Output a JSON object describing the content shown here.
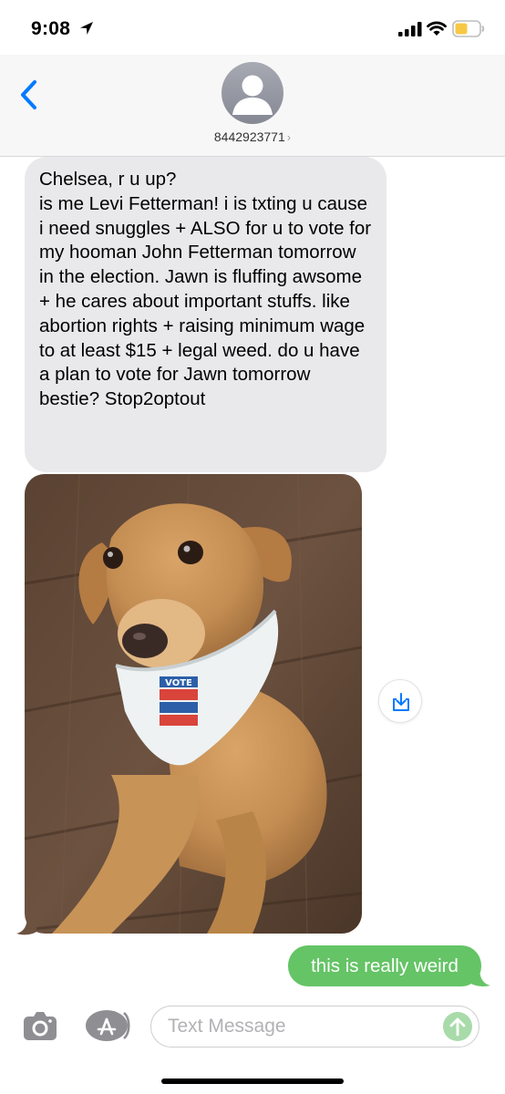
{
  "status_bar": {
    "time": "9:08",
    "location_icon": "location-arrow-icon",
    "signal_icon": "cellular-signal-icon",
    "wifi_icon": "wifi-icon",
    "battery_icon": "battery-low-icon",
    "battery_color": "#f7c844"
  },
  "header": {
    "back_icon": "chevron-left-icon",
    "avatar_icon": "person-silhouette-icon",
    "contact_number": "8442923771",
    "contact_chevron": "›",
    "accent_color": "#007aff"
  },
  "messages": {
    "incoming_text": "Chelsea, r u up?\nis me Levi Fetterman! i is txting u cause i need snuggles + ALSO for u to vote for my hooman John Fetterman tomorrow in the election. Jawn is fluffing awsome + he cares about important stuffs. like abortion rights + raising minimum wage to at least $15 + legal weed. do u have a plan to vote for Jawn tomorrow bestie? Stop2optout",
    "incoming_photo": "dog-photo-with-vote-bandana",
    "bandana_text": "VOTE",
    "save_icon": "download-icon",
    "outgoing_text": "this is really weird",
    "incoming_bubble_color": "#e9e9eb",
    "outgoing_bubble_color": "#65c466"
  },
  "input_bar": {
    "camera_icon": "camera-icon",
    "appstore_icon": "app-store-icon",
    "placeholder": "Text Message",
    "send_icon": "arrow-up-icon"
  }
}
